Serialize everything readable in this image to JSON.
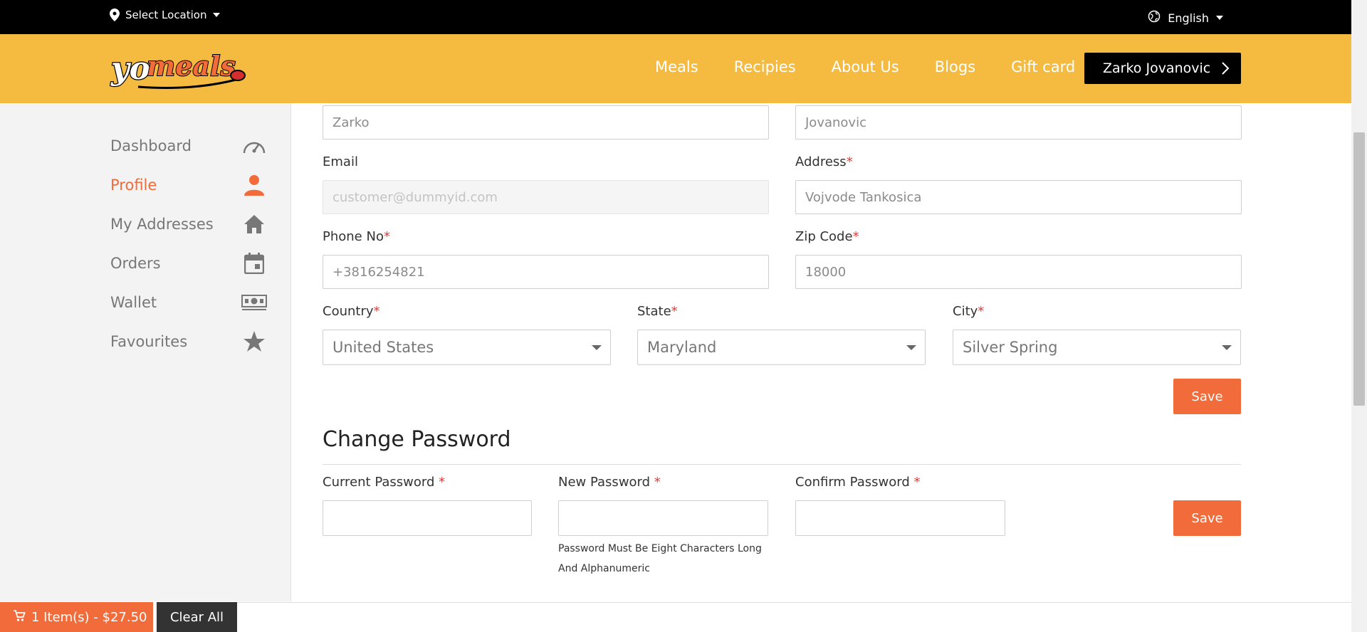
{
  "topbar": {
    "location_label": "Select Location",
    "language_label": "English"
  },
  "header": {
    "logo_text": "yomeals",
    "nav": [
      "Meals",
      "Recipies",
      "About Us",
      "Blogs",
      "Gift card"
    ],
    "user_name": "Zarko Jovanovic"
  },
  "sidebar": {
    "items": [
      {
        "label": "Dashboard",
        "icon": "speedometer-icon",
        "active": false
      },
      {
        "label": "Profile",
        "icon": "person-icon",
        "active": true
      },
      {
        "label": "My Addresses",
        "icon": "home-icon",
        "active": false
      },
      {
        "label": "Orders",
        "icon": "calendar-icon",
        "active": false
      },
      {
        "label": "Wallet",
        "icon": "money-icon",
        "active": false
      },
      {
        "label": "Favourites",
        "icon": "star-icon",
        "active": false
      }
    ]
  },
  "profile_form": {
    "first_name": {
      "value": "Zarko"
    },
    "last_name": {
      "value": "Jovanovic"
    },
    "email": {
      "label": "Email",
      "placeholder": "customer@dummyid.com",
      "disabled": true
    },
    "address": {
      "label": "Address",
      "value": "Vojvode Tankosica",
      "required": true
    },
    "phone": {
      "label": "Phone No",
      "value": "+3816254821",
      "required": true
    },
    "zip": {
      "label": "Zip Code",
      "value": "18000",
      "required": true
    },
    "country": {
      "label": "Country",
      "value": "United States",
      "required": true
    },
    "state": {
      "label": "State",
      "value": "Maryland",
      "required": true
    },
    "city": {
      "label": "City",
      "value": "Silver Spring",
      "required": true
    },
    "save_label": "Save"
  },
  "password_form": {
    "title": "Change Password",
    "current_label": "Current Password ",
    "new_label": "New Password ",
    "confirm_label": "Confirm Password ",
    "hint": "Password Must Be Eight Characters Long And Alphanumeric",
    "save_label": "Save"
  },
  "cart": {
    "summary": "1 Item(s) - $27.50",
    "clear_label": "Clear All"
  },
  "colors": {
    "brand_yellow": "#f5bb41",
    "accent_orange": "#f26b3a",
    "topbar_black": "#000000",
    "required_red": "#e53935"
  }
}
